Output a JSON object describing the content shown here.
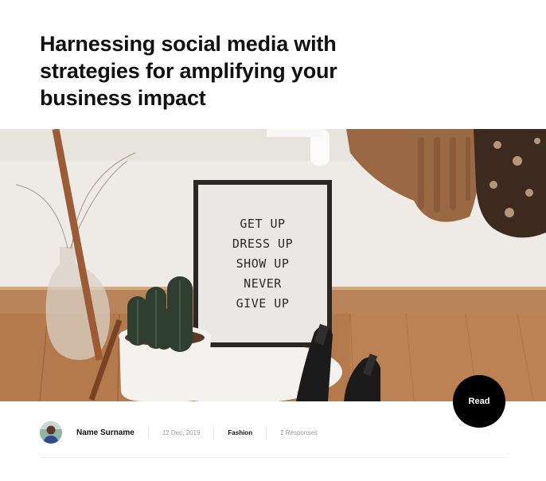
{
  "article": {
    "title": "Harnessing social media with strategies for amplifying your business impact",
    "hero_image": {
      "letter_board_lines": [
        "GET UP",
        "DRESS UP",
        "SHOW UP",
        "NEVER",
        "GIVE UP"
      ]
    },
    "read_button": {
      "label": "Read"
    },
    "meta": {
      "author": "Name Surname",
      "date": "12 Dec, 2019",
      "category": "Fashion",
      "responses": "2 Responses"
    }
  },
  "colors": {
    "title": "#111111",
    "read_button_bg": "#000000",
    "muted_text": "#9a9a9a",
    "divider": "#eeeeee"
  }
}
